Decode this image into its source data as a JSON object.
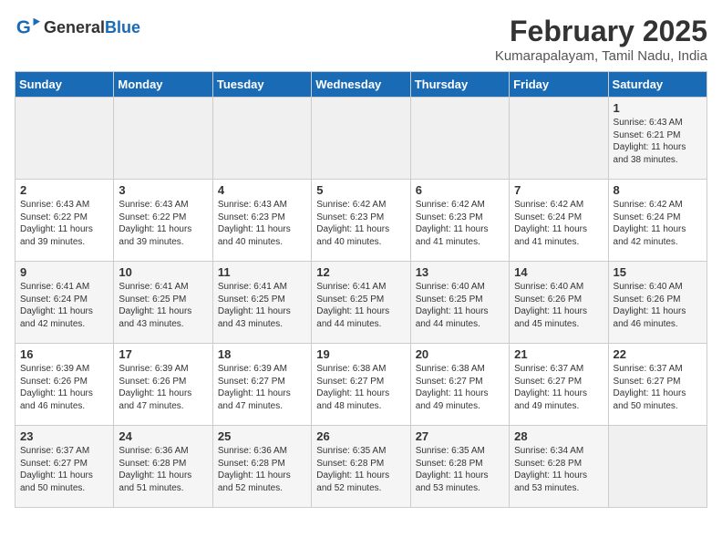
{
  "logo": {
    "text_general": "General",
    "text_blue": "Blue"
  },
  "title": "February 2025",
  "subtitle": "Kumarapalayam, Tamil Nadu, India",
  "days_of_week": [
    "Sunday",
    "Monday",
    "Tuesday",
    "Wednesday",
    "Thursday",
    "Friday",
    "Saturday"
  ],
  "weeks": [
    [
      {
        "day": "",
        "info": ""
      },
      {
        "day": "",
        "info": ""
      },
      {
        "day": "",
        "info": ""
      },
      {
        "day": "",
        "info": ""
      },
      {
        "day": "",
        "info": ""
      },
      {
        "day": "",
        "info": ""
      },
      {
        "day": "1",
        "info": "Sunrise: 6:43 AM\nSunset: 6:21 PM\nDaylight: 11 hours and 38 minutes."
      }
    ],
    [
      {
        "day": "2",
        "info": "Sunrise: 6:43 AM\nSunset: 6:22 PM\nDaylight: 11 hours and 39 minutes."
      },
      {
        "day": "3",
        "info": "Sunrise: 6:43 AM\nSunset: 6:22 PM\nDaylight: 11 hours and 39 minutes."
      },
      {
        "day": "4",
        "info": "Sunrise: 6:43 AM\nSunset: 6:23 PM\nDaylight: 11 hours and 40 minutes."
      },
      {
        "day": "5",
        "info": "Sunrise: 6:42 AM\nSunset: 6:23 PM\nDaylight: 11 hours and 40 minutes."
      },
      {
        "day": "6",
        "info": "Sunrise: 6:42 AM\nSunset: 6:23 PM\nDaylight: 11 hours and 41 minutes."
      },
      {
        "day": "7",
        "info": "Sunrise: 6:42 AM\nSunset: 6:24 PM\nDaylight: 11 hours and 41 minutes."
      },
      {
        "day": "8",
        "info": "Sunrise: 6:42 AM\nSunset: 6:24 PM\nDaylight: 11 hours and 42 minutes."
      }
    ],
    [
      {
        "day": "9",
        "info": "Sunrise: 6:41 AM\nSunset: 6:24 PM\nDaylight: 11 hours and 42 minutes."
      },
      {
        "day": "10",
        "info": "Sunrise: 6:41 AM\nSunset: 6:25 PM\nDaylight: 11 hours and 43 minutes."
      },
      {
        "day": "11",
        "info": "Sunrise: 6:41 AM\nSunset: 6:25 PM\nDaylight: 11 hours and 43 minutes."
      },
      {
        "day": "12",
        "info": "Sunrise: 6:41 AM\nSunset: 6:25 PM\nDaylight: 11 hours and 44 minutes."
      },
      {
        "day": "13",
        "info": "Sunrise: 6:40 AM\nSunset: 6:25 PM\nDaylight: 11 hours and 44 minutes."
      },
      {
        "day": "14",
        "info": "Sunrise: 6:40 AM\nSunset: 6:26 PM\nDaylight: 11 hours and 45 minutes."
      },
      {
        "day": "15",
        "info": "Sunrise: 6:40 AM\nSunset: 6:26 PM\nDaylight: 11 hours and 46 minutes."
      }
    ],
    [
      {
        "day": "16",
        "info": "Sunrise: 6:39 AM\nSunset: 6:26 PM\nDaylight: 11 hours and 46 minutes."
      },
      {
        "day": "17",
        "info": "Sunrise: 6:39 AM\nSunset: 6:26 PM\nDaylight: 11 hours and 47 minutes."
      },
      {
        "day": "18",
        "info": "Sunrise: 6:39 AM\nSunset: 6:27 PM\nDaylight: 11 hours and 47 minutes."
      },
      {
        "day": "19",
        "info": "Sunrise: 6:38 AM\nSunset: 6:27 PM\nDaylight: 11 hours and 48 minutes."
      },
      {
        "day": "20",
        "info": "Sunrise: 6:38 AM\nSunset: 6:27 PM\nDaylight: 11 hours and 49 minutes."
      },
      {
        "day": "21",
        "info": "Sunrise: 6:37 AM\nSunset: 6:27 PM\nDaylight: 11 hours and 49 minutes."
      },
      {
        "day": "22",
        "info": "Sunrise: 6:37 AM\nSunset: 6:27 PM\nDaylight: 11 hours and 50 minutes."
      }
    ],
    [
      {
        "day": "23",
        "info": "Sunrise: 6:37 AM\nSunset: 6:27 PM\nDaylight: 11 hours and 50 minutes."
      },
      {
        "day": "24",
        "info": "Sunrise: 6:36 AM\nSunset: 6:28 PM\nDaylight: 11 hours and 51 minutes."
      },
      {
        "day": "25",
        "info": "Sunrise: 6:36 AM\nSunset: 6:28 PM\nDaylight: 11 hours and 52 minutes."
      },
      {
        "day": "26",
        "info": "Sunrise: 6:35 AM\nSunset: 6:28 PM\nDaylight: 11 hours and 52 minutes."
      },
      {
        "day": "27",
        "info": "Sunrise: 6:35 AM\nSunset: 6:28 PM\nDaylight: 11 hours and 53 minutes."
      },
      {
        "day": "28",
        "info": "Sunrise: 6:34 AM\nSunset: 6:28 PM\nDaylight: 11 hours and 53 minutes."
      },
      {
        "day": "",
        "info": ""
      }
    ]
  ]
}
